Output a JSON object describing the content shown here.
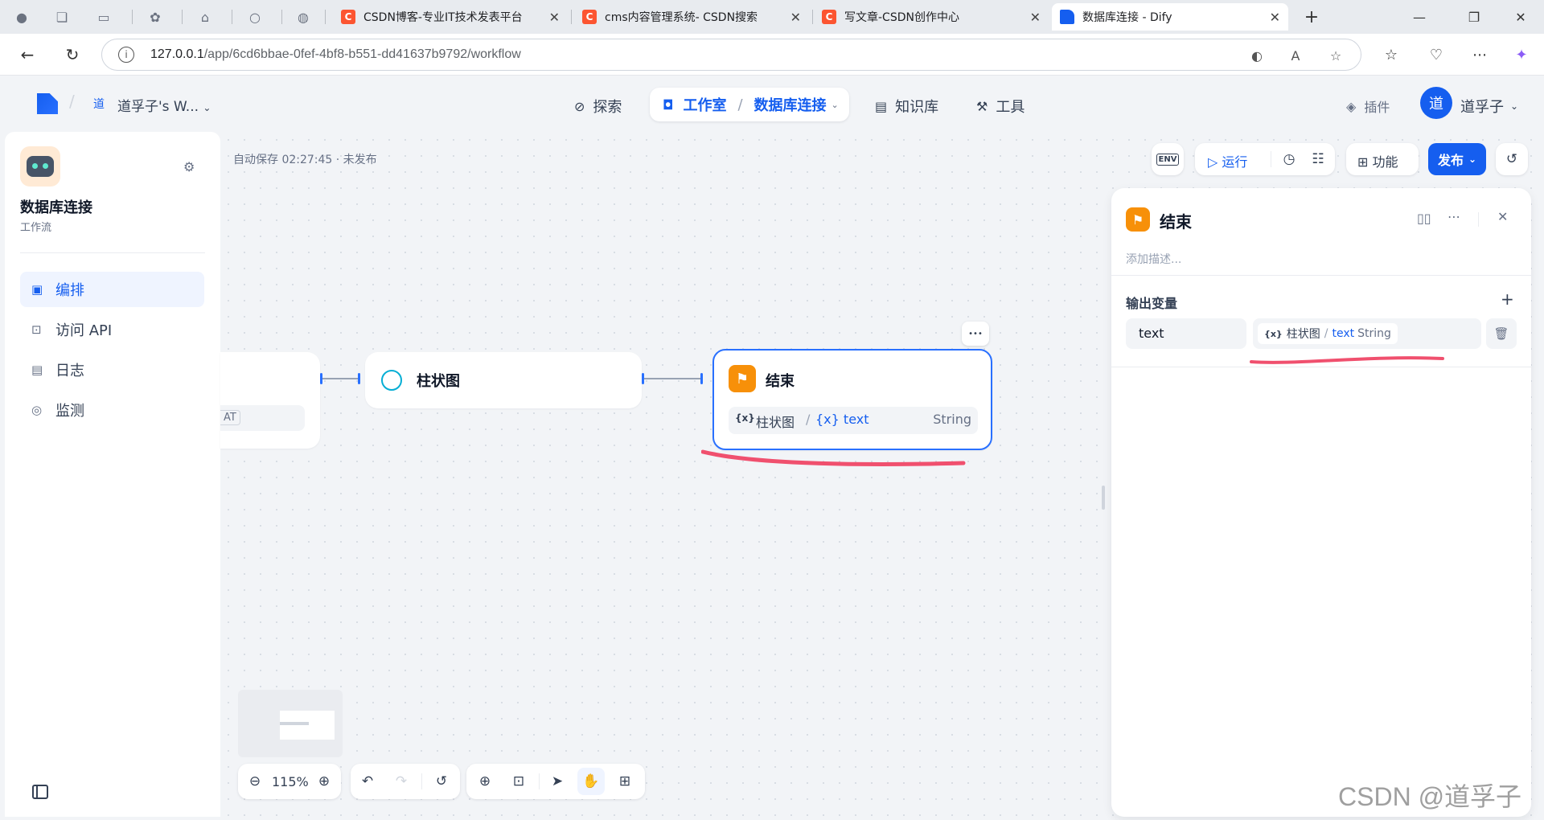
{
  "browser": {
    "tabs": [
      {
        "title": "CSDN博客-专业IT技术发表平台",
        "favicon": "C"
      },
      {
        "title": "cms内容管理系统- CSDN搜索",
        "favicon": "C"
      },
      {
        "title": "写文章-CSDN创作中心",
        "favicon": "C"
      },
      {
        "title": "数据库连接 - Dify",
        "favicon": ""
      }
    ],
    "url_host": "127.0.0.1",
    "url_path": "/app/6cd6bbae-0fef-4bf8-b551-dd41637b9792/workflow",
    "icons": {
      "back": "←",
      "reload": "↻",
      "info": "i",
      "new_tab": "+",
      "minimize": "—",
      "restore": "❐",
      "close": "✕"
    }
  },
  "header": {
    "workspace_avatar": "道",
    "workspace_name": "道孚子's W...",
    "nav": {
      "explore": "探索",
      "studio": "工作室",
      "current_app": "数据库连接",
      "knowledge": "知识库",
      "tools": "工具",
      "plugins": "插件"
    },
    "user_avatar": "道",
    "user_name": "道孚子"
  },
  "sidebar": {
    "app_name": "数据库连接",
    "app_type": "工作流",
    "items": [
      {
        "label": "编排",
        "active": true
      },
      {
        "label": "访问 API",
        "active": false
      },
      {
        "label": "日志",
        "active": false
      },
      {
        "label": "监测",
        "active": false
      }
    ]
  },
  "canvas": {
    "autosave": "自动保存 02:27:45 · 未发布",
    "toolbar": {
      "env": "ENV",
      "run": "运行",
      "features": "功能",
      "publish": "发布"
    },
    "nodes": {
      "start_partial_tag": "AT",
      "chart_node_title": "柱状图",
      "end_node_title": "结束",
      "end_node_more": "•••",
      "end_var_prefix": "{x}",
      "end_var_source": "柱状图",
      "end_var_sep": "/",
      "end_var_name": "{x} text",
      "end_var_type": "String"
    },
    "zoom": "115%"
  },
  "panel": {
    "title": "结束",
    "description_placeholder": "添加描述...",
    "output_section": "输出变量",
    "outputs": [
      {
        "name": "text",
        "var_prefix": "{x}",
        "source": "柱状图",
        "sep": "/",
        "var": "text",
        "type": "String"
      }
    ]
  },
  "watermark": "CSDN @道孚子",
  "colors": {
    "accent": "#155eef",
    "end_node": "#f79009",
    "annotation": "#f0506e"
  }
}
